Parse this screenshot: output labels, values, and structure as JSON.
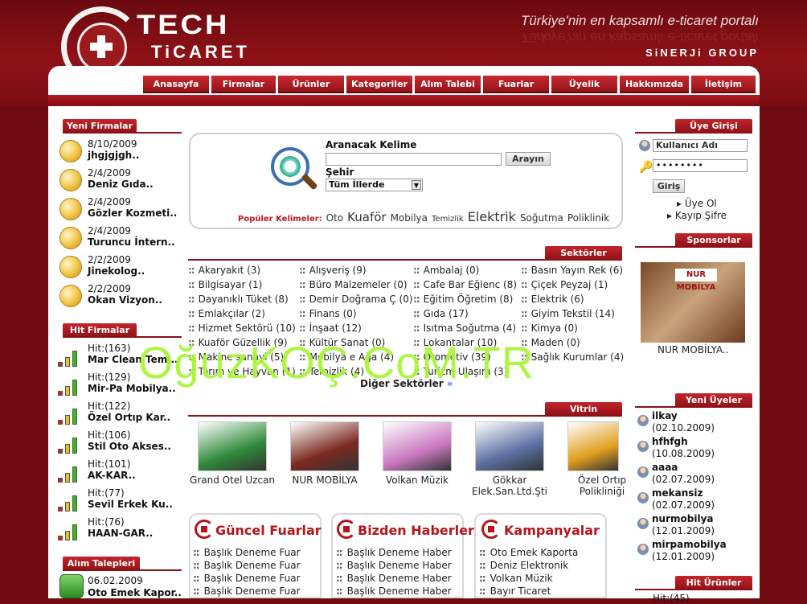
{
  "brand": {
    "tech": "TECH",
    "ticaret": "TiCARET",
    "slogan": "Türkiye'nin en kapsamlı e-ticaret portalı",
    "group": "SiNERJi GROUP"
  },
  "nav": [
    "Anasayfa",
    "Firmalar",
    "Ürünler",
    "Kategoriler",
    "Alım Talebi",
    "Fuarlar",
    "Üyelik",
    "Hakkımızda",
    "İletişim"
  ],
  "yeni_firmalar": {
    "title": "Yeni Firmalar",
    "items": [
      {
        "date": "8/10/2009",
        "name": "jhgjgjgh.."
      },
      {
        "date": "2/4/2009",
        "name": "Deniz Gıda.."
      },
      {
        "date": "2/4/2009",
        "name": "Gözler Kozmeti.."
      },
      {
        "date": "2/4/2009",
        "name": "Turuncu İntern.."
      },
      {
        "date": "2/2/2009",
        "name": "Jinekolog.."
      },
      {
        "date": "2/2/2009",
        "name": "Okan Vizyon.."
      }
    ]
  },
  "hit_firmalar": {
    "title": "Hit Firmalar",
    "items": [
      {
        "hit": "Hit:(163)",
        "name": "Mar Clean Temi.."
      },
      {
        "hit": "Hit:(129)",
        "name": "Mir-Pa Mobilya.."
      },
      {
        "hit": "Hit:(122)",
        "name": "Özel Ortıp Kar.."
      },
      {
        "hit": "Hit:(106)",
        "name": "Stil Oto Akses.."
      },
      {
        "hit": "Hit:(101)",
        "name": "AK-KAR.."
      },
      {
        "hit": "Hit:(77)",
        "name": "Sevil Erkek Ku.."
      },
      {
        "hit": "Hit:(76)",
        "name": "HAAN-GAR.."
      }
    ]
  },
  "alim_talepleri": {
    "title": "Alım Talepleri",
    "items": [
      {
        "date": "06.02.2009",
        "name": "Oto Emek Kapor.."
      }
    ]
  },
  "search": {
    "kelime_label": "Aranacak Kelime",
    "kelime_value": "",
    "button": "Arayın",
    "sehir_label": "Şehir",
    "sehir_value": "Tüm İllerde",
    "popular_label": "Popüler Kelimeler:",
    "popular": [
      {
        "t": "Oto",
        "s": 12
      },
      {
        "t": "Kuaför",
        "s": 15
      },
      {
        "t": "Mobilya",
        "s": 12
      },
      {
        "t": "Temizlik",
        "s": 10
      },
      {
        "t": "Elektrik",
        "s": 16
      },
      {
        "t": "Soğutma",
        "s": 12
      },
      {
        "t": "Poliklinik",
        "s": 12
      }
    ]
  },
  "sektorler": {
    "title": "Sektörler",
    "more": "Diğer Sektörler",
    "items": [
      [
        "Akaryakıt (3)",
        "Alışveriş (9)",
        "Ambalaj (0)",
        "Basın Yayın Rek (6)"
      ],
      [
        "Bilgisayar (1)",
        "Büro Malzemeler (0)",
        "Cafe Bar Eğlenc (8)",
        "Çiçek Peyzaj (1)"
      ],
      [
        "Dayanıklı Tüket (8)",
        "Demir Doğrama Ç (0)",
        "Eğitim Öğretim  (8)",
        "Elektrik (6)"
      ],
      [
        "Emlakçılar (2)",
        "Finans (0)",
        "Gıda (17)",
        "Giyim Tekstil (14)"
      ],
      [
        "Hizmet Sektörü (10)",
        "İnşaat (12)",
        "Isıtma Soğutma  (4)",
        "Kimya (0)"
      ],
      [
        "Kuaför Güzellik (9)",
        "Kültür Sanat (0)",
        "Lokantalar (10)",
        "Maden (0)"
      ],
      [
        "Makine sanayi (5)",
        "Mobilya e Ağa (4)",
        "Otomotiv (39)",
        "Sağlık Kurumlar (4)"
      ],
      [
        "Tarım ve Hayvan (1)",
        "Temizlik (4)",
        "Turizm Ulaşım (3)",
        ""
      ]
    ]
  },
  "vitrin": {
    "title": "Vitrin",
    "items": [
      {
        "name": "Grand Otel Uzcan",
        "color": "#2f8a3a"
      },
      {
        "name": "NUR MOBİLYA",
        "color": "#7a2a20"
      },
      {
        "name": "Volkan Müzik",
        "color": "#c978c0"
      },
      {
        "name": "Gökkar Elek.San.Ltd.Şti",
        "color": "#5a6fa0"
      },
      {
        "name": "Özel Ortıp Polikliniği",
        "color": "#e0a020"
      }
    ]
  },
  "fuarlar": {
    "title": "Güncel Fuarlar",
    "items": [
      "Başlık Deneme Fuar",
      "Başlık Deneme Fuar",
      "Başlık Deneme Fuar",
      "Başlık Deneme Fuar"
    ]
  },
  "haberler": {
    "title": "Bizden Haberler",
    "items": [
      "Başlık Deneme Haber",
      "Başlık Deneme Haber",
      "Başlık Deneme Haber",
      "Başlık Deneme Haber"
    ]
  },
  "kampanyalar": {
    "title": "Kampanyalar",
    "items": [
      "Oto Emek Kaporta",
      "Deniz Elektronik",
      "Volkan Müzik",
      "Bayır Ticaret"
    ]
  },
  "login": {
    "title": "Üye Girişi",
    "username_placeholder": "Kullanıcı Adı",
    "password_value": "••••••••",
    "button": "Giriş",
    "register": "Üye Ol",
    "forgot": "Kayıp Şifre"
  },
  "sponsorlar": {
    "title": "Sponsorlar",
    "name": "NUR MOBİLYA..",
    "logo": "NUR MOBİLYA"
  },
  "yeni_uyeler": {
    "title": "Yeni Üyeler",
    "items": [
      {
        "name": "ilkay",
        "date": "(02.10.2009)"
      },
      {
        "name": "hfhfgh",
        "date": "(10.08.2009)"
      },
      {
        "name": "aaaa",
        "date": "(02.07.2009)"
      },
      {
        "name": "mekansiz",
        "date": "(02.07.2009)"
      },
      {
        "name": "nurmobilya",
        "date": "(12.01.2009)"
      },
      {
        "name": "mirpamobilya",
        "date": "(12.01.2009)"
      }
    ]
  },
  "hit_urunler": {
    "title": "Hit Ürünler",
    "first": "Hit:(45)"
  },
  "watermark": "OğuzKOÇ.CoM.TR"
}
